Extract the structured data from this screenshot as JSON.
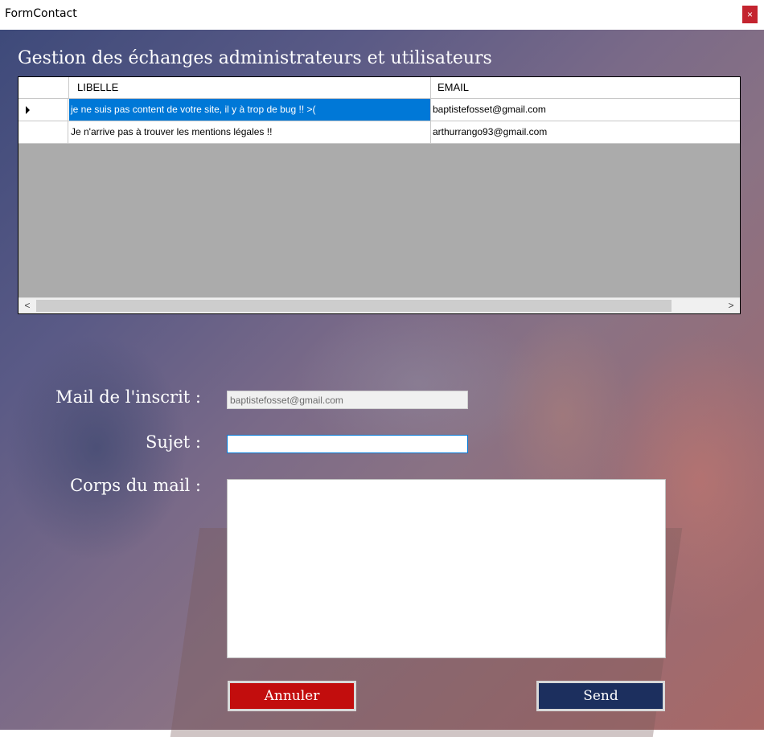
{
  "window": {
    "title": "FormContact",
    "close_glyph": "×"
  },
  "heading": "Gestion des échanges administrateurs et utilisateurs",
  "grid": {
    "columns": [
      "LIBELLE",
      "EMAIL"
    ],
    "rows": [
      {
        "libelle": "je ne suis pas content de votre site, il y à trop de bug !! >(",
        "email": "baptistefosset@gmail.com",
        "selected": true
      },
      {
        "libelle": "Je n'arrive pas à trouver les mentions légales !!",
        "email": "arthurrango93@gmail.com",
        "selected": false
      }
    ],
    "scroll_left": "<",
    "scroll_right": ">"
  },
  "form": {
    "mail_label": "Mail de l'inscrit :",
    "mail_value": "baptistefosset@gmail.com",
    "sujet_label": "Sujet :",
    "sujet_value": "",
    "corps_label": "Corps du mail :",
    "corps_value": ""
  },
  "buttons": {
    "cancel": "Annuler",
    "send": "Send"
  },
  "colors": {
    "selection": "#0078d7",
    "cancel": "#c20d0d",
    "send": "#1c2f5e",
    "close": "#c4242f"
  }
}
